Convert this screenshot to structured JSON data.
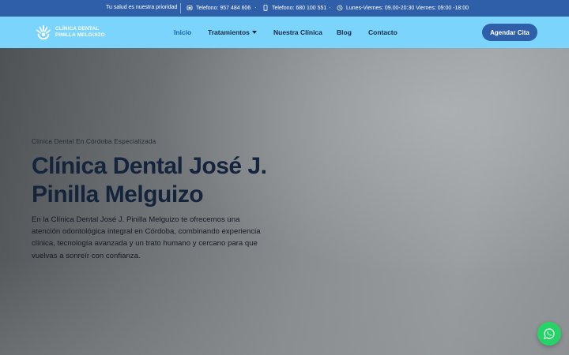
{
  "topbar": {
    "tagline": "Tu salud es nuestra prioridad",
    "phone1": "Telefono: 957 484 606",
    "phone2": "Telefono: 680 100 551",
    "hours": "Lunes-Viernes: 09.00-20:30 Viernes: 09:00 -18:00",
    "icons": [
      "phone-icon",
      "mobile-icon",
      "clock-icon"
    ]
  },
  "header": {
    "logo_line1": "CLÍNICA DENTAL",
    "logo_line2": "PINILLA MELGUIZO",
    "nav": [
      "Inicio",
      "Tratamientos",
      "Nuestra Clínica",
      "Blog",
      "Contacto"
    ],
    "active": "Inicio",
    "cta": "Agendar Cita"
  },
  "hero": {
    "eyebrow": "Clinica Dental En Córdoba Especializada",
    "title": "Clínica Dental José J. Pinilla Melguizo",
    "lead": "En la Clínica Dental José J. Pinilla Melguizo te ofrecemos una atención odontológica integral en Córdoba, combinando experiencia clínica, tecnología avanzada y un trato humano y cercano para que vuelvas a sonreír con confianza."
  },
  "colors": {
    "topbar": "#2f5fa8",
    "header": "#7ad4fb",
    "cta": "#2f5fa8",
    "whatsapp": "#25d366",
    "title": "#14243c"
  }
}
